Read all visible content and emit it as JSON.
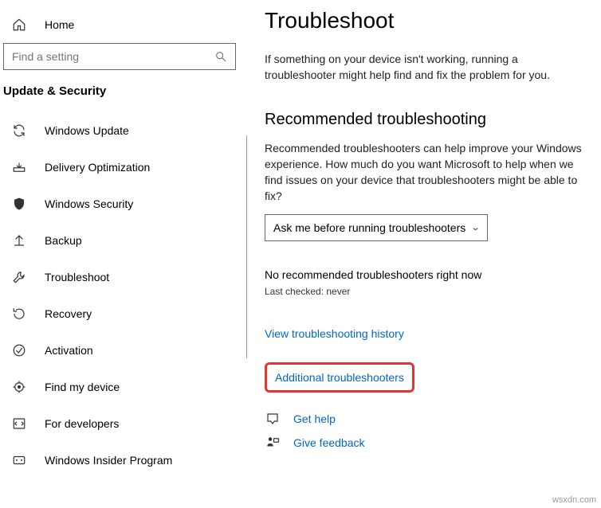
{
  "sidebar": {
    "home_label": "Home",
    "search_placeholder": "Find a setting",
    "category_title": "Update & Security",
    "items": [
      {
        "label": "Windows Update"
      },
      {
        "label": "Delivery Optimization"
      },
      {
        "label": "Windows Security"
      },
      {
        "label": "Backup"
      },
      {
        "label": "Troubleshoot"
      },
      {
        "label": "Recovery"
      },
      {
        "label": "Activation"
      },
      {
        "label": "Find my device"
      },
      {
        "label": "For developers"
      },
      {
        "label": "Windows Insider Program"
      }
    ]
  },
  "main": {
    "title": "Troubleshoot",
    "intro": "If something on your device isn't working, running a troubleshooter might help find and fix the problem for you.",
    "section_title": "Recommended troubleshooting",
    "section_text": "Recommended troubleshooters can help improve your Windows experience. How much do you want Microsoft to help when we find issues on your device that troubleshooters might be able to fix?",
    "dropdown_value": "Ask me before running troubleshooters",
    "status": "No recommended troubleshooters right now",
    "last_checked": "Last checked: never",
    "link_history": "View troubleshooting history",
    "link_additional": "Additional troubleshooters",
    "link_help": "Get help",
    "link_feedback": "Give feedback"
  },
  "watermark": "wsxdn.com"
}
